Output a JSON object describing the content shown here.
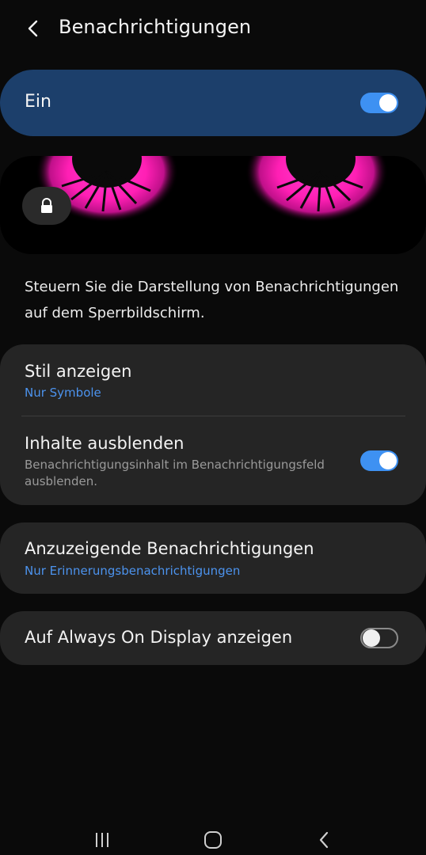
{
  "header": {
    "title": "Benachrichtigungen"
  },
  "master_switch": {
    "label": "Ein",
    "state": "on"
  },
  "description": "Steuern Sie die Darstellung von Benachrichtigungen auf dem Sperrbildschirm.",
  "settings": {
    "show_style": {
      "title": "Stil anzeigen",
      "value": "Nur Symbole"
    },
    "hide_content": {
      "title": "Inhalte ausblenden",
      "description": "Benachrichtigungsinhalt im Benachrichtigungsfeld ausblenden.",
      "state": "on"
    },
    "notifications_to_show": {
      "title": "Anzuzeigende Benachrichtigungen",
      "value": "Nur Erinnerungsbenachrichtigungen"
    },
    "always_on_display": {
      "title": "Auf Always On Display anzeigen",
      "state": "off"
    }
  },
  "colors": {
    "accent": "#3e91f2",
    "master_background": "#1c3f6b",
    "card_background": "#252525",
    "wallpaper_magenta": "#ff1fb4"
  },
  "icons": [
    "back-arrow-icon",
    "lock-icon",
    "recent-apps-icon",
    "home-icon",
    "back-icon"
  ]
}
